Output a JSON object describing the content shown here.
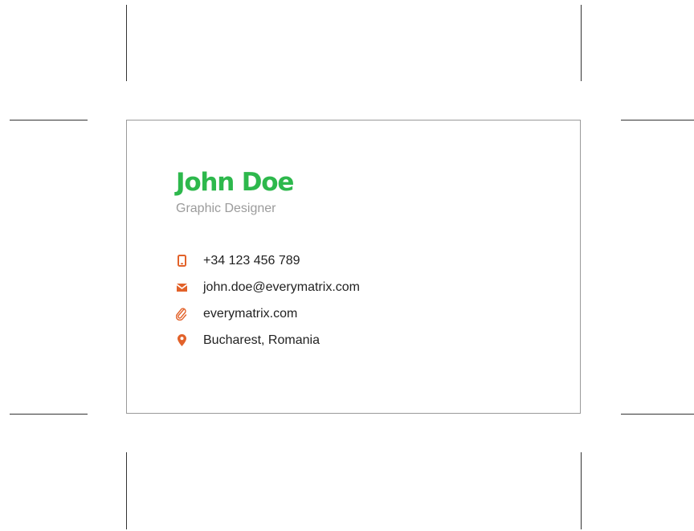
{
  "card": {
    "name": "John Doe",
    "title": "Graphic Designer",
    "contacts": [
      {
        "icon": "phone-icon",
        "text": "+34 123 456 789"
      },
      {
        "icon": "email-icon",
        "text": "john.doe@everymatrix.com"
      },
      {
        "icon": "link-icon",
        "text": "everymatrix.com"
      },
      {
        "icon": "location-pin-icon",
        "text": "Bucharest, Romania"
      }
    ]
  },
  "colors": {
    "name": "#2db84c",
    "icon": "#e2622a",
    "title": "#9b9b9b",
    "text": "#222222"
  }
}
